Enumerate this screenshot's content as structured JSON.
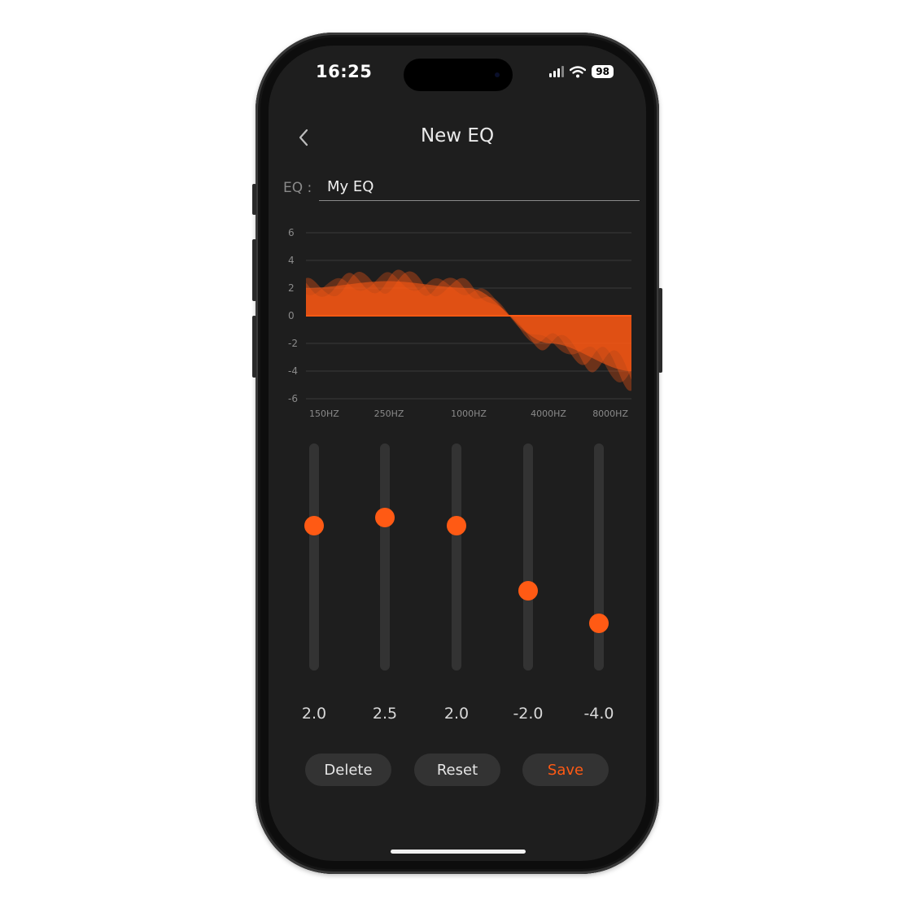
{
  "status_bar": {
    "time": "16:25",
    "battery": "98"
  },
  "header": {
    "title": "New EQ",
    "back_icon": "chevron-left-icon"
  },
  "eq_name": {
    "label": "EQ :",
    "value": "My EQ"
  },
  "colors": {
    "accent": "#ff5a14",
    "background": "#1e1e1e",
    "button_bg": "#333333"
  },
  "chart_data": {
    "type": "area",
    "y_ticks": [
      "6",
      "4",
      "2",
      "0",
      "-2",
      "-4",
      "-6"
    ],
    "ylim": [
      -6,
      6
    ],
    "x_labels": [
      "150HZ",
      "250HZ",
      "1000HZ",
      "4000HZ",
      "8000HZ"
    ],
    "grid": true
  },
  "bands": [
    {
      "value": 2.0,
      "label": "2.0"
    },
    {
      "value": 2.5,
      "label": "2.5"
    },
    {
      "value": 2.0,
      "label": "2.0"
    },
    {
      "value": -2.0,
      "label": "-2.0"
    },
    {
      "value": -4.0,
      "label": "-4.0"
    }
  ],
  "buttons": {
    "delete": "Delete",
    "reset": "Reset",
    "save": "Save"
  }
}
